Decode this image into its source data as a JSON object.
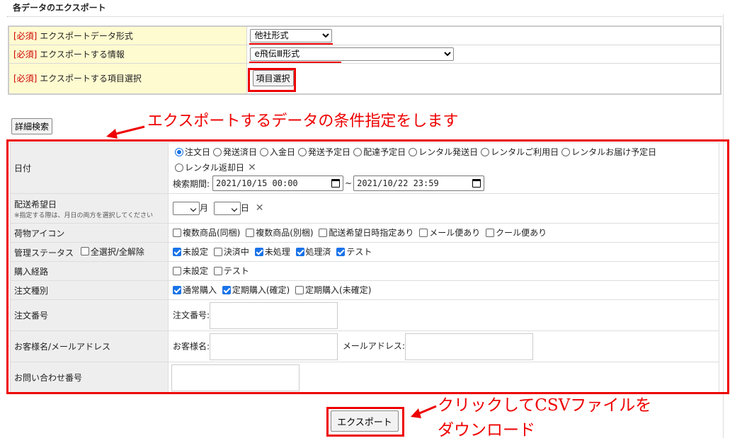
{
  "page_title": "各データのエクスポート",
  "required_section": {
    "required_tag": "[必須]",
    "rows": [
      {
        "label": "エクスポートデータ形式",
        "control": "select",
        "value": "他社形式"
      },
      {
        "label": "エクスポートする情報",
        "control": "select",
        "value": "e飛伝Ⅲ形式"
      },
      {
        "label": "エクスポートする項目選択",
        "control": "button",
        "value": "項目選択"
      }
    ]
  },
  "detail_search_button": "詳細検索",
  "annotation_conditions": "エクスポートするデータの条件指定をします",
  "annotation_export": [
    "クリックしてCSVファイルを",
    "ダウンロード"
  ],
  "colors": {
    "annotation": "#e00000",
    "required": "#cc0000",
    "checked": "#1a73e8",
    "required_bg": "#fffbd0"
  },
  "conditions": {
    "date": {
      "label": "日付",
      "options": [
        {
          "text": "注文日",
          "checked": true
        },
        {
          "text": "発送済日",
          "checked": false
        },
        {
          "text": "入金日",
          "checked": false
        },
        {
          "text": "発送予定日",
          "checked": false
        },
        {
          "text": "配達予定日",
          "checked": false
        },
        {
          "text": "レンタル発送日",
          "checked": false
        },
        {
          "text": "レンタルご利用日",
          "checked": false
        },
        {
          "text": "レンタルお届け予定日",
          "checked": false
        },
        {
          "text": "レンタル返却日",
          "checked": false
        }
      ],
      "period_label": "検索期間:",
      "from": "2021/10/15 00:00",
      "separator": "~",
      "to": "2021/10/22 23:59"
    },
    "delivery_request": {
      "label": "配送希望日",
      "note": "※指定する際は、月日の両方を選択してください",
      "month_suffix": "月",
      "day_suffix": "日"
    },
    "package_icon": {
      "label": "荷物アイコン",
      "options": [
        {
          "text": "複数商品(同梱)",
          "checked": false
        },
        {
          "text": "複数商品(別梱)",
          "checked": false
        },
        {
          "text": "配送希望日時指定あり",
          "checked": false
        },
        {
          "text": "メール便あり",
          "checked": false
        },
        {
          "text": "クール便あり",
          "checked": false
        }
      ]
    },
    "management_status": {
      "label": "管理ステータス",
      "select_all": "全選択/全解除",
      "options": [
        {
          "text": "未設定",
          "checked": true
        },
        {
          "text": "決済中",
          "checked": false
        },
        {
          "text": "未処理",
          "checked": true
        },
        {
          "text": "処理済",
          "checked": true
        },
        {
          "text": "テスト",
          "checked": true
        }
      ]
    },
    "purchase_route": {
      "label": "購入経路",
      "options": [
        {
          "text": "未設定",
          "checked": false
        },
        {
          "text": "テスト",
          "checked": false
        }
      ]
    },
    "order_type": {
      "label": "注文種別",
      "options": [
        {
          "text": "通常購入",
          "checked": true
        },
        {
          "text": "定期購入(確定)",
          "checked": true
        },
        {
          "text": "定期購入(未確定)",
          "checked": false
        }
      ]
    },
    "order_number": {
      "label": "注文番号",
      "field_label": "注文番号:"
    },
    "customer": {
      "label": "お客様名/メールアドレス",
      "name_label": "お客様名:",
      "mail_label": "メールアドレス:"
    },
    "inquiry_number": {
      "label": "お問い合わせ番号"
    }
  },
  "export_button": "エクスポート"
}
